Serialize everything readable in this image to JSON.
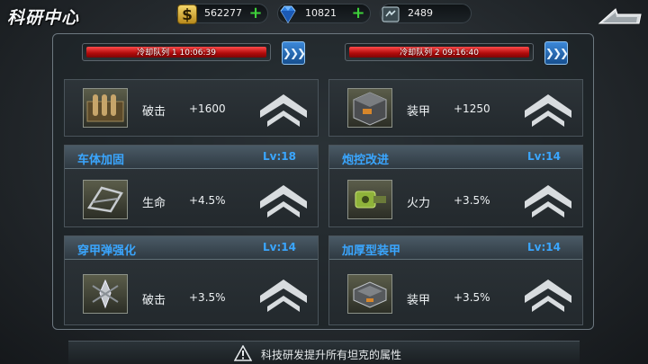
{
  "header": {
    "title": "科研中心",
    "coins": {
      "value": "562277",
      "icon": "gold-coin-icon"
    },
    "gems": {
      "value": "10821",
      "icon": "blue-diamond-icon"
    },
    "tickets": {
      "value": "2489",
      "icon": "tech-book-icon"
    },
    "back_icon": "back-arrow-icon"
  },
  "queues": [
    {
      "label": "冷却队列 1",
      "time": "10:06:39",
      "text": "冷却队列 1    10:06:39"
    },
    {
      "label": "冷却队列 2",
      "time": "09:16:40",
      "text": "冷却队列 2    09:16:40"
    }
  ],
  "cards": [
    {
      "name": "",
      "level": "",
      "stat": "破击",
      "amount": "+1600",
      "icon": "ammo-crate-icon"
    },
    {
      "name": "",
      "level": "",
      "stat": "装甲",
      "amount": "+1250",
      "icon": "armor-box-icon"
    },
    {
      "name": "车体加固",
      "level": "Lv:18",
      "stat": "生命",
      "amount": "+4.5%",
      "icon": "chassis-frame-icon"
    },
    {
      "name": "炮控改进",
      "level": "Lv:14",
      "stat": "火力",
      "amount": "+3.5%",
      "icon": "gun-control-icon"
    },
    {
      "name": "穿甲弹强化",
      "level": "Lv:14",
      "stat": "破击",
      "amount": "+3.5%",
      "icon": "ap-shell-icon"
    },
    {
      "name": "加厚型装甲",
      "level": "Lv:14",
      "stat": "装甲",
      "amount": "+3.5%",
      "icon": "thick-armor-icon"
    }
  ],
  "footer": {
    "text": "科技研发提升所有坦克的属性"
  },
  "colors": {
    "accent": "#3aa6ff",
    "bar_red": "#d01414",
    "plus_green": "#3ed13a"
  }
}
